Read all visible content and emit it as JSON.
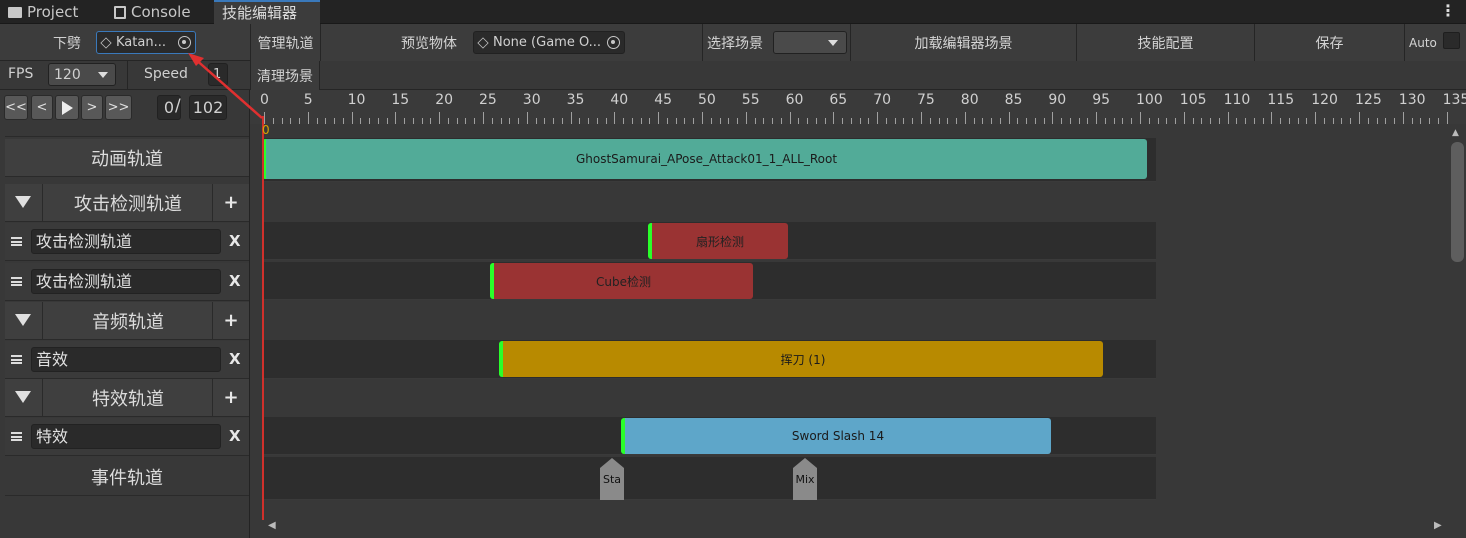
{
  "tabs": [
    {
      "label": "Project",
      "icon": "folder-icon"
    },
    {
      "label": "Console",
      "icon": "console-icon"
    },
    {
      "label": "技能编辑器",
      "icon": ""
    }
  ],
  "toolbar": {
    "weapon_label": "下劈",
    "weapon_value": "Katan...",
    "manage_tracks": "管理轨道",
    "preview_object_label": "预览物体",
    "preview_object_value": "None (Game O...",
    "select_scene_label": "选择场景",
    "load_editor_scene": "加载编辑器场景",
    "skill_config": "技能配置",
    "save": "保存",
    "auto_label": "Auto",
    "clear_scene": "清理场景",
    "fps_label": "FPS",
    "fps_value": "120",
    "speed_label": "Speed",
    "speed_value": "1"
  },
  "playback": {
    "rewind": "<<",
    "prev": "<",
    "next": ">",
    "fastforward": ">>",
    "current_frame": "0",
    "separator": "/",
    "total_frames": "102"
  },
  "ruler": {
    "labels": [
      "0",
      "5",
      "10",
      "15",
      "20",
      "25",
      "30",
      "35",
      "40",
      "45",
      "50",
      "55",
      "60",
      "65",
      "70",
      "75",
      "80",
      "85",
      "90",
      "95",
      "100",
      "105",
      "110",
      "115",
      "120",
      "125",
      "130",
      "135"
    ],
    "playhead_label": "0"
  },
  "track_panel": {
    "animation_track": "动画轨道",
    "attack_group": "攻击检测轨道",
    "attack_items": [
      "攻击检测轨道",
      "攻击检测轨道"
    ],
    "audio_group": "音频轨道",
    "audio_items": [
      "音效"
    ],
    "effect_group": "特效轨道",
    "effect_items": [
      "特效"
    ],
    "event_track": "事件轨道",
    "add_symbol": "+",
    "remove_symbol": "X"
  },
  "clips": {
    "animation": "GhostSamurai_APose_Attack01_1_ALL_Root",
    "fan_detect": "扇形检测",
    "cube_detect": "Cube检测",
    "audio": "挥刀 (1)",
    "effect": "Sword Slash 14"
  },
  "events": [
    "Sta",
    "Mix"
  ],
  "colors": {
    "animation_clip": "#52ab98",
    "detect_clip": "#9a3333",
    "audio_clip": "#b88a00",
    "effect_clip": "#5ea6c9",
    "clip_start_marker": "#2aff2a",
    "playhead": "#d0302b",
    "accent": "#3a79bb"
  }
}
